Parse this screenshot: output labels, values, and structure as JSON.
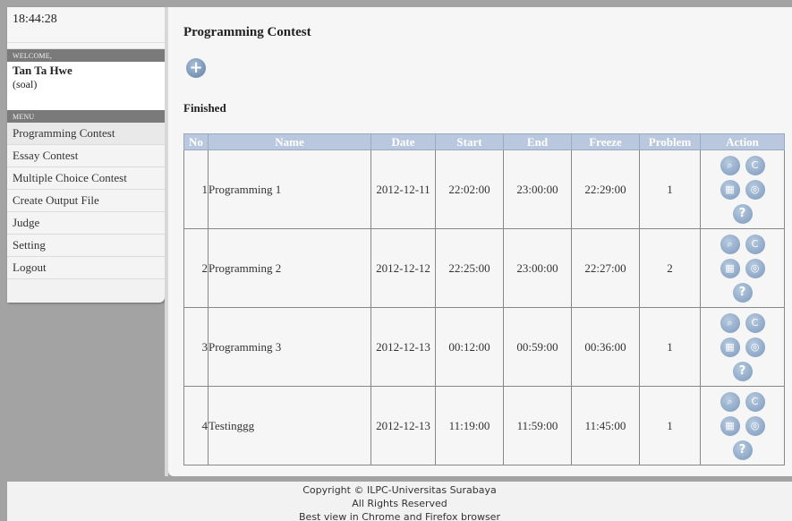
{
  "clock": "18:44:28",
  "welcome": {
    "heading": "WELCOME,",
    "name": "Tan Ta Hwe",
    "role": "(soal)"
  },
  "menu": {
    "heading": "MENU",
    "items": [
      {
        "label": "Programming Contest"
      },
      {
        "label": "Essay Contest"
      },
      {
        "label": "Multiple Choice Contest"
      },
      {
        "label": "Create Output File"
      },
      {
        "label": "Judge"
      },
      {
        "label": "Setting"
      },
      {
        "label": "Logout"
      }
    ]
  },
  "main": {
    "title": "Programming Contest",
    "add_icon": "plus-icon",
    "section": "Finished",
    "columns": [
      "No",
      "Name",
      "Date",
      "Start",
      "End",
      "Freeze",
      "Problem",
      "Action"
    ],
    "rows": [
      {
        "no": "1",
        "name": "Programming 1",
        "date": "2012-12-11",
        "start": "22:02:00",
        "end": "23:00:00",
        "freeze": "22:29:00",
        "problem": "1"
      },
      {
        "no": "2",
        "name": "Programming 2",
        "date": "2012-12-12",
        "start": "22:25:00",
        "end": "23:00:00",
        "freeze": "22:27:00",
        "problem": "2"
      },
      {
        "no": "3",
        "name": "Programming 3",
        "date": "2012-12-13",
        "start": "00:12:00",
        "end": "00:59:00",
        "freeze": "00:36:00",
        "problem": "1"
      },
      {
        "no": "4",
        "name": "Testinggg",
        "date": "2012-12-13",
        "start": "11:19:00",
        "end": "11:59:00",
        "freeze": "11:45:00",
        "problem": "1"
      }
    ],
    "action_icons": [
      "magnifier-icon",
      "language-icon",
      "scoreboard-icon",
      "output-icon",
      "help-icon"
    ]
  },
  "footer": {
    "line1": "Copyright © ILPC-Universitas Surabaya",
    "line2": "All Rights Reserved",
    "line3": "Best view in Chrome and Firefox browser"
  },
  "colors": {
    "header_bg": "#b9c8de",
    "page_bg": "#a3a3a3",
    "icon_blue": "#7b98bb"
  }
}
